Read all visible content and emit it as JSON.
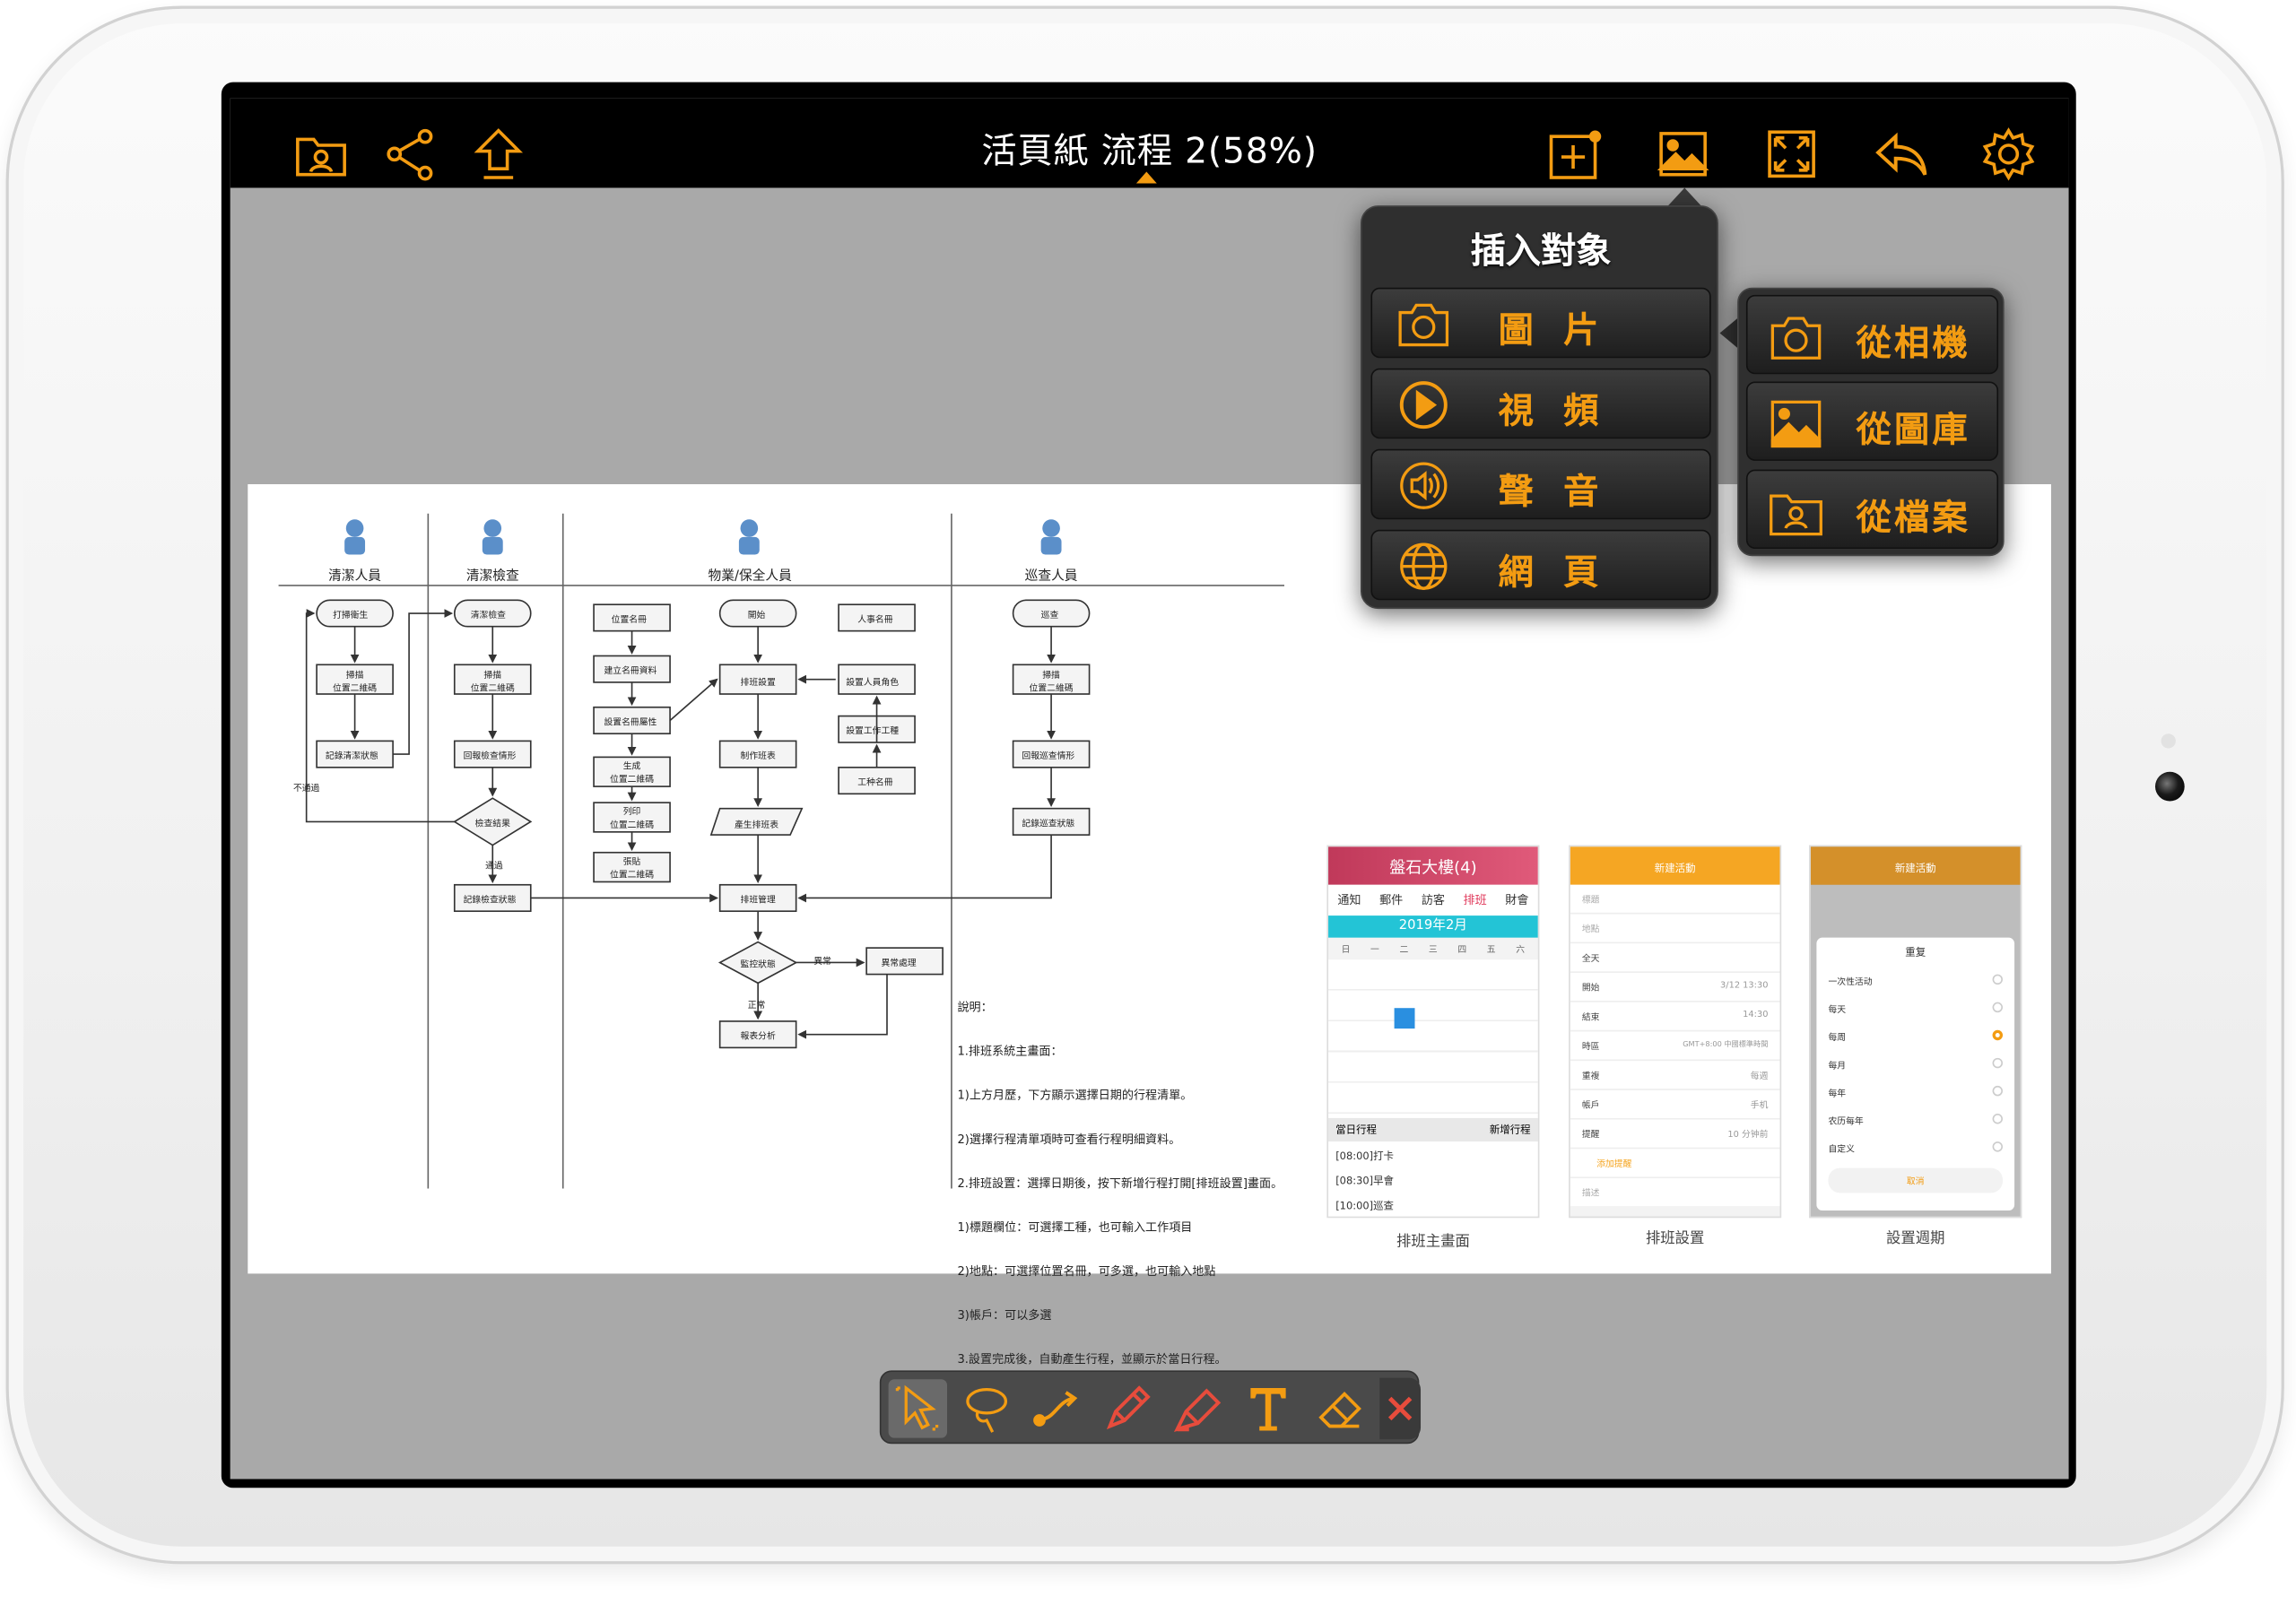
{
  "topbar": {
    "title": "活頁紙 流程 2(58%)",
    "left_icons": [
      "folder-user-icon",
      "share-icon",
      "upload-icon"
    ],
    "right_icons": [
      "add-page-icon",
      "image-icon",
      "fullscreen-icon",
      "undo-icon",
      "settings-icon"
    ]
  },
  "insert_menu": {
    "title": "插入對象",
    "items": [
      {
        "label": "圖 片",
        "icon": "camera-icon"
      },
      {
        "label": "視 頻",
        "icon": "play-icon"
      },
      {
        "label": "聲 音",
        "icon": "speaker-icon"
      },
      {
        "label": "網 頁",
        "icon": "globe-icon"
      }
    ]
  },
  "image_submenu": {
    "items": [
      {
        "label": "從相機",
        "icon": "camera-icon"
      },
      {
        "label": "從圖庫",
        "icon": "gallery-icon"
      },
      {
        "label": "從檔案",
        "icon": "folder-user-icon"
      }
    ]
  },
  "document": {
    "lanes": [
      "清潔人員",
      "清潔檢查",
      "物業/保全人員",
      "巡查人員"
    ],
    "flow_labels": {
      "l1": [
        "打掃衛生",
        "掃描\n位置二維碼",
        "記錄清潔狀態",
        "不通過"
      ],
      "l2": [
        "清潔檢查",
        "掃描\n位置二維碼",
        "回報檢查情形",
        "檢查結果",
        "通過",
        "記錄檢查狀態"
      ],
      "l3a": [
        "位置名冊",
        "建立名冊資料",
        "設置名冊屬性",
        "生成\n位置二維碼",
        "列印\n位置二維碼",
        "張貼\n位置二維碼"
      ],
      "l3b": [
        "開始",
        "排班設置",
        "制作班表",
        "產生排班表",
        "排班管理",
        "監控狀態",
        "異常",
        "正常",
        "報表分析",
        "異常處理"
      ],
      "l3c": [
        "人事名冊",
        "設置人員角色",
        "設置工作工種",
        "工种名冊"
      ],
      "l4": [
        "巡查",
        "掃描\n位置二維碼",
        "回報巡查情形",
        "記錄巡查狀態"
      ]
    },
    "notes": [
      "說明：",
      "1.排班系統主畫面：",
      "1)上方月歷，下方顯示選擇日期的行程清單。",
      "2)選擇行程清單項時可查看行程明細資料。",
      "2.排班設置：選擇日期後，按下新增行程打開[排班設置]畫面。",
      "1)標題欄位：可選擇工種，也可輸入工作項目",
      "2)地點：可選擇位置名冊，可多選，也可輸入地點",
      "3)帳戶：可以多選",
      "3.設置完成後，自動產生行程，並顯示於當日行程。"
    ],
    "screenshots": [
      {
        "caption": "排班主畫面",
        "header": "盤石大樓(4)",
        "tabs": [
          "通知",
          "郵件",
          "訪客",
          "排班",
          "財會"
        ],
        "month": "2019年2月",
        "weekdays": [
          "日",
          "一",
          "二",
          "三",
          "四",
          "五",
          "六"
        ],
        "section_left": "當日行程",
        "section_right": "新增行程",
        "events": [
          "[08:00]打卡",
          "[08:30]早會",
          "[10:00]巡查"
        ]
      },
      {
        "caption": "排班設置",
        "header": "新建活動",
        "rows": [
          "標題",
          "地點",
          "全天",
          "開始",
          "結束",
          "時區",
          "重複",
          "帳戶",
          "提醒",
          "添加提醒",
          "描述"
        ],
        "values": [
          "",
          "",
          "",
          "3/12 13:30",
          "14:30",
          "GMT+8:00 中國標準時間",
          "每週",
          "手机",
          "10 分钟前",
          "",
          ""
        ]
      },
      {
        "caption": "設置週期",
        "header": "新建活動",
        "dialog_title": "重复",
        "options": [
          "一次性活动",
          "每天",
          "每周",
          "每月",
          "每年",
          "农历每年",
          "自定义"
        ],
        "selected_index": 2,
        "cancel": "取消"
      }
    ]
  },
  "bottom_toolbar": {
    "tools": [
      "select-icon",
      "lasso-icon",
      "connector-icon",
      "pencil-icon",
      "highlighter-icon",
      "text-icon",
      "eraser-icon",
      "close-icon"
    ],
    "selected": "select-icon",
    "accent_color": "#f39c12",
    "red_color": "#e74c3c"
  }
}
